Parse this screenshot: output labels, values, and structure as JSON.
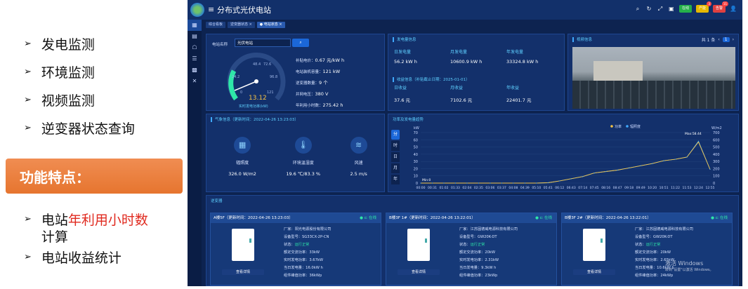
{
  "slide": {
    "bullets": [
      "发电监测",
      "环境监测",
      "视频监测",
      "逆变器状态查询"
    ],
    "feature_title": "功能特点：",
    "bullets2": [
      {
        "pre": "电站",
        "red": "年利用小时数",
        "post": "计算"
      },
      {
        "pre": "电站收益统计",
        "red": "",
        "post": ""
      }
    ],
    "arrow": "➢"
  },
  "app": {
    "title": "分布式光伏电站",
    "tabs": [
      "综合看板",
      "逆变器状态 ×",
      "● 电站状态 ×"
    ],
    "badges": [
      "在线",
      "产能",
      "告警"
    ],
    "badge_counts": [
      "",
      "3",
      "11"
    ]
  },
  "station": {
    "name_label": "电站名称",
    "name_value": "光伏电站",
    "gauge": {
      "value": "13.12",
      "label": "实时发电功率(kW)",
      "ticks": [
        "24.2",
        "48.4",
        "72.6",
        "96.8",
        "0",
        "121"
      ]
    },
    "fields": [
      {
        "label": "补贴电价：",
        "value": "0.67 元/kW h"
      },
      {
        "label": "电站装机容量：",
        "value": "121 kW"
      },
      {
        "label": "逆变器数量：",
        "value": "9 个"
      },
      {
        "label": "并网电压：",
        "value": "380 V"
      },
      {
        "label": "年利用小时数：",
        "value": "275.42 h"
      }
    ]
  },
  "generation": {
    "title": "发电量信息",
    "items": [
      {
        "label": "日发电量",
        "value": "56.2 kW h"
      },
      {
        "label": "月发电量",
        "value": "10600.9 kW h"
      },
      {
        "label": "年发电量",
        "value": "33324.8 kW h"
      }
    ]
  },
  "revenue": {
    "title": "收益信息（补贴截止日期：2025-01-01）",
    "items": [
      {
        "label": "日收益",
        "value": "37.6 元"
      },
      {
        "label": "月收益",
        "value": "7102.6 元"
      },
      {
        "label": "年收益",
        "value": "22401.7 元"
      }
    ]
  },
  "video": {
    "title": "视频信息",
    "pager": "共 1 条",
    "page": "1"
  },
  "weather": {
    "title": "气象信息（更新时间：2022-04-26 13:23:03）",
    "items": [
      {
        "label": "辐照度",
        "value": "326.0 W/m2"
      },
      {
        "label": "环境温湿度",
        "value": "19.6 ℃/83.3 %"
      },
      {
        "label": "风速",
        "value": "2.5 m/s"
      }
    ]
  },
  "chart_data": {
    "type": "line",
    "title": "功率及发电量趋势",
    "legend": [
      "功率",
      "辐照度"
    ],
    "left_unit": "kW",
    "right_unit": "W/m2",
    "yleft": [
      0,
      10,
      20,
      30,
      40,
      50,
      60,
      70
    ],
    "yright": [
      0,
      100,
      200,
      300,
      400,
      500,
      600,
      700
    ],
    "ylim": [
      0,
      70
    ],
    "ylim_right": [
      0,
      700
    ],
    "xticks": [
      "00:00",
      "00:31",
      "01:02",
      "01:33",
      "02:04",
      "02:35",
      "03:06",
      "03:37",
      "04:08",
      "04:39",
      "05:10",
      "05:41",
      "06:12",
      "06:43",
      "07:14",
      "07:45",
      "08:16",
      "08:47",
      "09:18",
      "09:49",
      "10:20",
      "10:51",
      "11:22",
      "11:53",
      "12:24",
      "12:55"
    ],
    "annotations": [
      "Min:0",
      "Max:58.44"
    ],
    "tabs": [
      "分",
      "时",
      "日",
      "月",
      "年"
    ],
    "power": [
      0,
      0,
      0,
      0,
      0,
      0,
      0,
      0,
      0,
      0,
      0,
      0.5,
      3,
      6,
      9,
      14,
      16,
      18,
      21,
      24,
      27,
      31,
      33,
      36,
      57,
      19
    ],
    "irradiance": [
      0,
      0,
      0,
      0,
      0,
      0,
      0,
      0,
      0,
      0,
      0,
      5,
      30,
      60,
      90,
      140,
      160,
      180,
      210,
      240,
      270,
      310,
      330,
      360,
      580,
      190
    ]
  },
  "inverters": {
    "title": "逆变器",
    "online": "在线",
    "detail_btn": "查看详情",
    "cards": [
      {
        "title": "A楼5F（更新时间：2022-04-26 13:23:03）",
        "rows": [
          [
            "厂家：",
            "阳光电源股份有限公司"
          ],
          [
            "设备型号：",
            "SG33CX-2P-CN"
          ],
          [
            "状态：",
            "运行正常"
          ],
          [
            "额定交流功率：",
            "33kW"
          ],
          [
            "实时发电功率：",
            "3.67kW"
          ],
          [
            "当日发电量：",
            "16.0kW h"
          ],
          [
            "组件峰值功率：",
            "36kWp"
          ]
        ]
      },
      {
        "title": "B楼3F 1#（更新时间：2022-04-26 13:22:01）",
        "rows": [
          [
            "厂家：",
            "江苏固德威电源科技有限公司"
          ],
          [
            "设备型号：",
            "GW20K-DT"
          ],
          [
            "状态：",
            "运行正常"
          ],
          [
            "额定交流功率：",
            "20kW"
          ],
          [
            "实时发电功率：",
            "2.31kW"
          ],
          [
            "当日发电量：",
            "9.3kW h"
          ],
          [
            "组件峰值功率：",
            "23kWp"
          ]
        ]
      },
      {
        "title": "B楼3F 2#（更新时间：2022-04-26 13:22:01）",
        "rows": [
          [
            "厂家：",
            "江苏固德威电源科技有限公司"
          ],
          [
            "设备型号：",
            "GW20K-DT"
          ],
          [
            "状态：",
            "运行正常"
          ],
          [
            "额定交流功率：",
            "20kW"
          ],
          [
            "实时发电功率：",
            "2.65kW"
          ],
          [
            "当日发电量：",
            "10.6kW h"
          ],
          [
            "组件峰值功率：",
            "24kWp"
          ]
        ]
      }
    ]
  },
  "watermark": [
    "激活 Windows",
    "转到\"设置\"以激活 Windows。"
  ]
}
